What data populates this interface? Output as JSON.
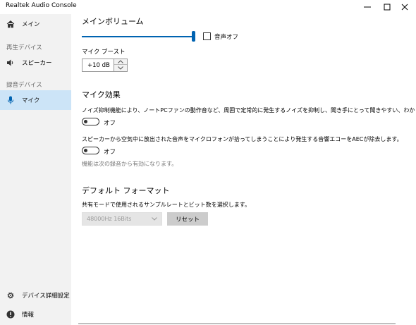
{
  "window": {
    "title": "Realtek Audio Console"
  },
  "sidebar": {
    "main_label": "メイン",
    "playback_header": "再生デバイス",
    "speaker_label": "スピーカー",
    "recording_header": "録音デバイス",
    "mic_label": "マイク",
    "advanced_label": "デバイス詳細設定",
    "info_label": "情報"
  },
  "volume": {
    "title": "メインボリューム",
    "level": 1.0,
    "mute_label": "音声オフ",
    "muted": false
  },
  "boost": {
    "label": "マイク ブースト",
    "value": "+10 dB"
  },
  "effects": {
    "title": "マイク効果",
    "noise_desc": "ノイズ抑制機能により、ノートPCファンの動作音など、周囲で定常的に発生するノイズを抑制し、聞き手にとって聞きやすい、わかりやすい音声とします。",
    "noise_toggle_label": "オフ",
    "aec_desc": "スピーカーから空気中に放出された音声をマイクロフォンが拾ってしまうことにより発生する音響エコーをAECが除去します。",
    "aec_toggle_label": "オフ",
    "note": "機能は次の録音から有効になります。"
  },
  "format": {
    "title": "デフォルト フォーマット",
    "desc": "共有モードで使用されるサンプルレートとビット数を選択します。",
    "selected": "48000Hz 16Bits",
    "reset_label": "リセット"
  },
  "colors": {
    "accent": "#0063b1",
    "sidebar_bg": "#f2f2f2",
    "active_bg": "#cce4f7"
  }
}
